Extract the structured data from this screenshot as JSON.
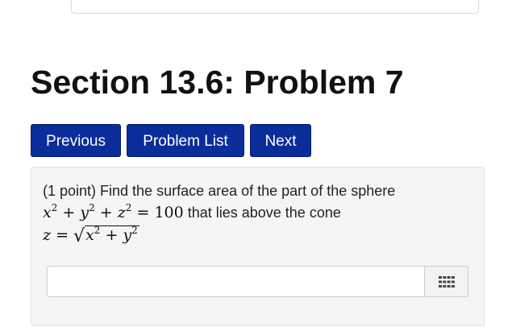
{
  "page": {
    "title": "Section 13.6: Problem 7"
  },
  "nav": {
    "previous_label": "Previous",
    "problem_list_label": "Problem List",
    "next_label": "Next",
    "button_color": "#0a2d9a"
  },
  "problem": {
    "intro": "(1 point) Find the surface area of the part of the sphere",
    "sphere_x": "x",
    "sphere_y": "y",
    "sphere_z": "z",
    "exp2": "2",
    "plus": "+",
    "equals": "=",
    "sphere_rhs": "100",
    "above_text": "that lies above the cone",
    "cone_lhs": "z",
    "sqrt_symbol": "√"
  },
  "answer": {
    "value": "",
    "keypad_icon": "keypad-grid-icon"
  }
}
